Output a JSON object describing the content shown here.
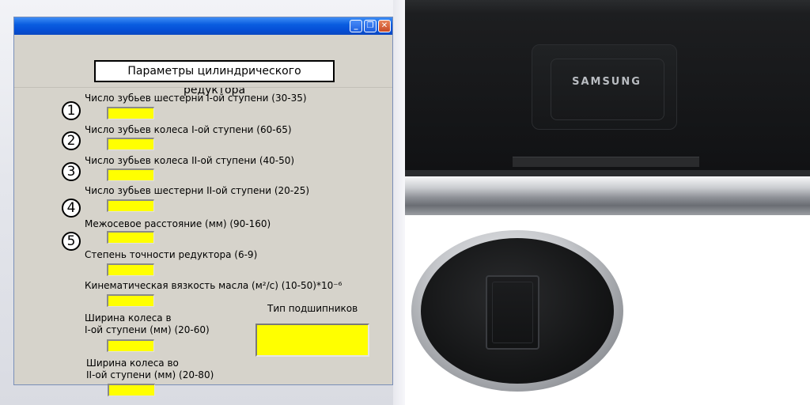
{
  "window": {
    "title_box": "Параметры цилиндрического редуктора",
    "controls": {
      "minimize": "_",
      "maximize": "❐",
      "close": "✕"
    }
  },
  "fields": [
    {
      "number": "1",
      "label": "Число зубьев шестерни I-ой ступени (30-35)"
    },
    {
      "number": "2",
      "label": "Число зубьев колеса I-ой ступени (60-65)"
    },
    {
      "number": "3",
      "label": "Число зубьев колеса II-ой ступени (40-50)"
    },
    {
      "number": "",
      "label": "Число зубьев шестерни II-ой ступени (20-25)"
    },
    {
      "number": "4",
      "label": ""
    },
    {
      "number": "",
      "label": "Межосевое расстояние (мм) (90-160)"
    },
    {
      "number": "5",
      "label": ""
    },
    {
      "number": "",
      "label": "Степень точности редуктора (6-9)"
    },
    {
      "number": "",
      "label": "Кинематическая вязкость масла (м²/с) (10-50)*10⁻⁶"
    },
    {
      "number": "",
      "label_line1": "Ширина колеса в",
      "label_line2": "I-ой ступени (мм) (20-60)"
    },
    {
      "number": "",
      "label_line1": "Ширина колеса во",
      "label_line2": "II-ой ступени (мм) (20-80)"
    }
  ],
  "bearing_type_label": "Тип подшипников",
  "monitor_back": {
    "brand": "SAMSUNG"
  },
  "colors": {
    "input_fill": "#ffff00",
    "form_bg": "#d6d3cb",
    "titlebar": "#0a5ee0"
  }
}
